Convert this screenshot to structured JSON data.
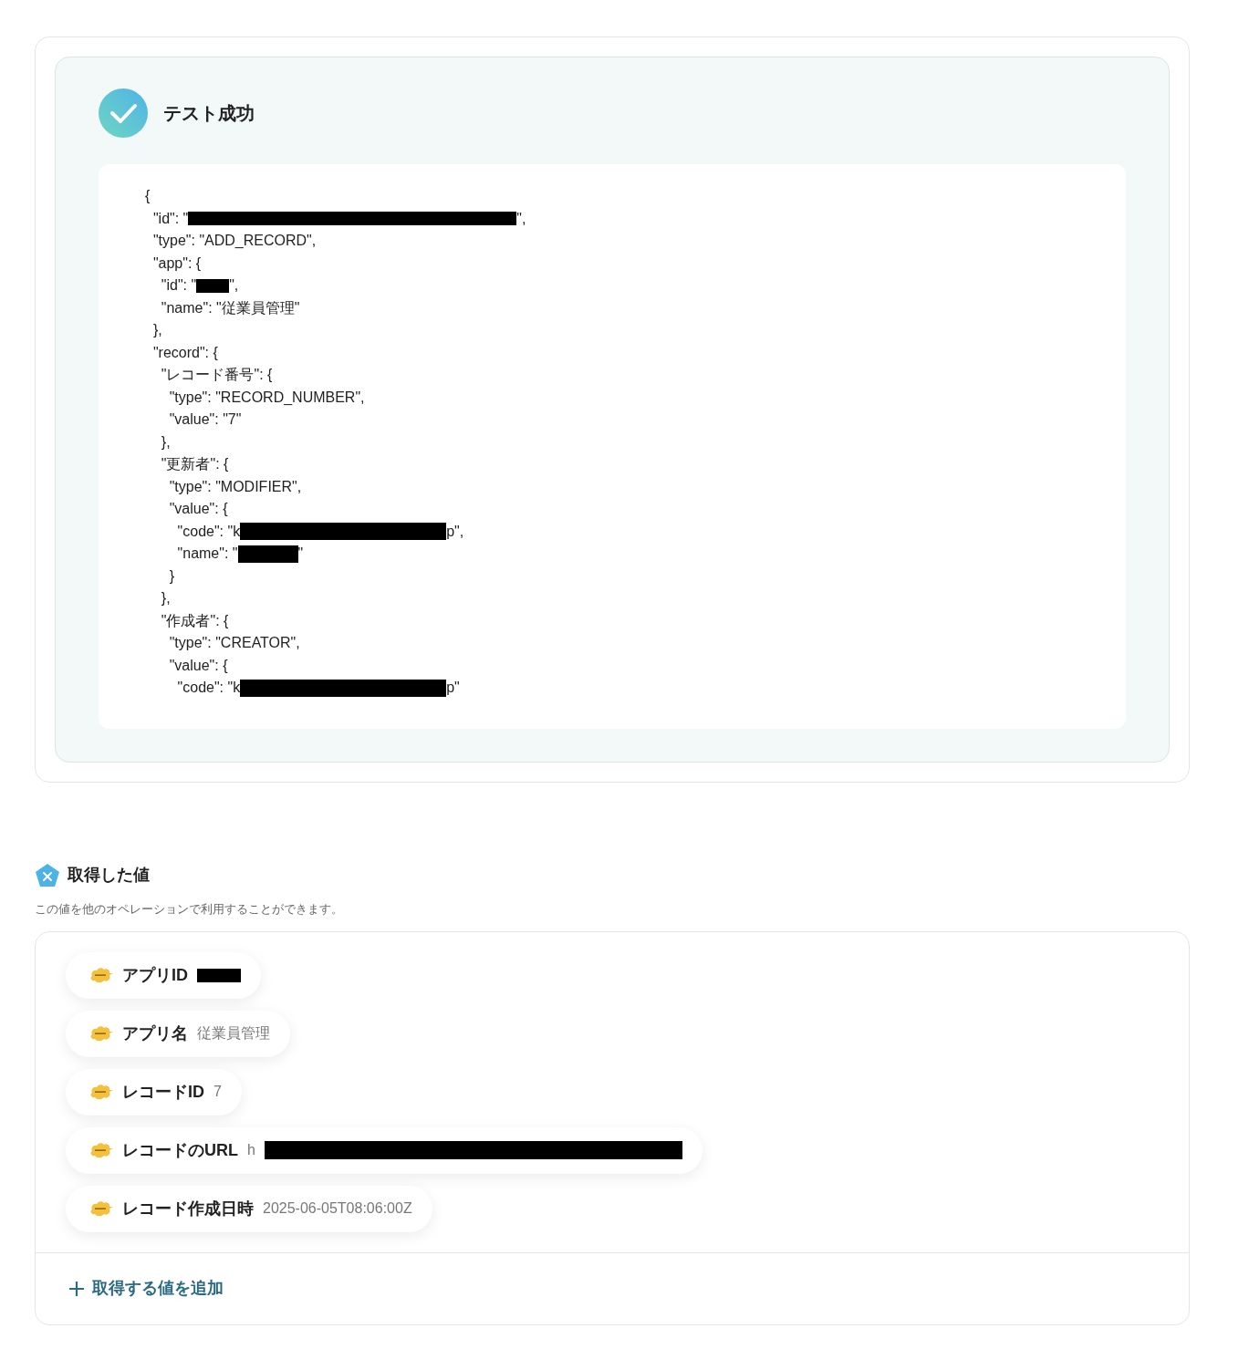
{
  "test_result": {
    "title": "テスト成功",
    "success": true,
    "code_lines": [
      {
        "text": "{"
      },
      {
        "text": "  \"id\": \"",
        "redacted": true,
        "after": "\","
      },
      {
        "text": "  \"type\": \"ADD_RECORD\","
      },
      {
        "text": "  \"app\": {"
      },
      {
        "text": "    \"id\": \"",
        "redacted": true,
        "after": "\","
      },
      {
        "text": "    \"name\": \"従業員管理\""
      },
      {
        "text": "  },"
      },
      {
        "text": "  \"record\": {"
      },
      {
        "text": "    \"レコード番号\": {"
      },
      {
        "text": "      \"type\": \"RECORD_NUMBER\","
      },
      {
        "text": "      \"value\": \"7\""
      },
      {
        "text": "    },"
      },
      {
        "text": "    \"更新者\": {"
      },
      {
        "text": "      \"type\": \"MODIFIER\","
      },
      {
        "text": "      \"value\": {"
      },
      {
        "text": "        \"code\": \"k",
        "redacted": true,
        "after": "p\","
      },
      {
        "text": "        \"name\": \"",
        "redacted": true,
        "after": "\""
      },
      {
        "text": "      }"
      },
      {
        "text": "    },"
      },
      {
        "text": "    \"作成者\": {"
      },
      {
        "text": "      \"type\": \"CREATOR\","
      },
      {
        "text": "      \"value\": {"
      },
      {
        "text": "        \"code\": \"k",
        "redacted": true,
        "after": "p\""
      }
    ]
  },
  "outputs": {
    "title": "取得した値",
    "description": "この値を他のオペレーションで利用することができます。",
    "items": [
      {
        "label": "アプリID",
        "redacted": true
      },
      {
        "label": "アプリ名",
        "value": "従業員管理"
      },
      {
        "label": "レコードID",
        "value": "7"
      },
      {
        "label": "レコードのURL",
        "value": "h",
        "redacted": true
      },
      {
        "label": "レコード作成日時",
        "value": "2025-06-05T08:06:00Z"
      }
    ],
    "add_button": "取得する値を追加"
  }
}
